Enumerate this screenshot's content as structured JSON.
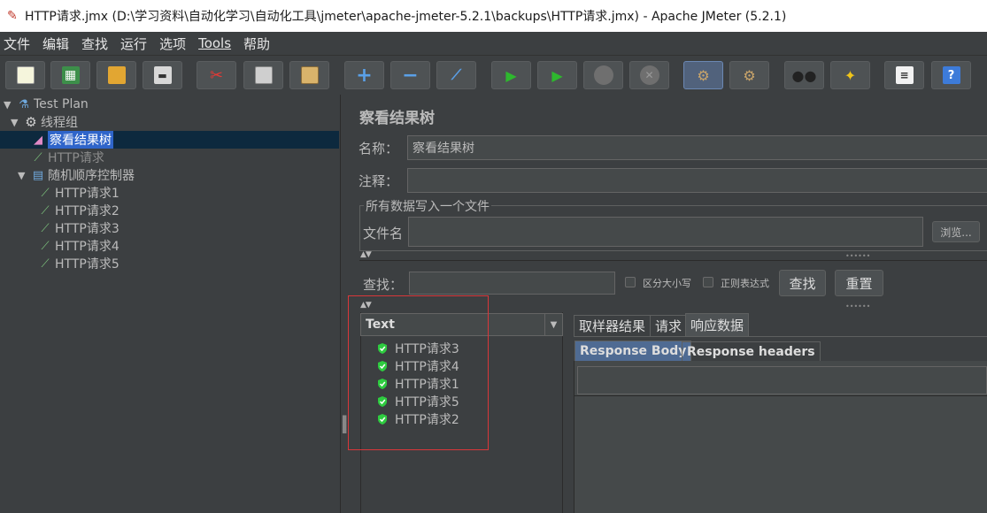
{
  "window": {
    "title": "HTTP请求.jmx (D:\\学习资料\\自动化学习\\自动化工具\\jmeter\\apache-jmeter-5.2.1\\backups\\HTTP请求.jmx) - Apache JMeter (5.2.1)"
  },
  "menu": [
    "文件",
    "编辑",
    "查找",
    "运行",
    "选项",
    "Tools",
    "帮助"
  ],
  "toolbar": {
    "icons": [
      "new-icon",
      "templates-icon",
      "open-icon",
      "save-icon",
      "cut-icon",
      "copy-icon",
      "paste-icon",
      "expand-icon",
      "collapse-icon",
      "toggle-icon",
      "start-icon",
      "start-no-pause-icon",
      "stop-icon",
      "shutdown-icon",
      "clear-icon",
      "clear-all-icon",
      "search-icon",
      "reset-search-icon",
      "function-helper-icon",
      "help-icon"
    ]
  },
  "tree": {
    "items": [
      {
        "label": "Test Plan",
        "icon": "test-plan-icon"
      },
      {
        "label": "线程组",
        "icon": "gear-icon"
      },
      {
        "label": "察看结果树",
        "icon": "chart-icon"
      },
      {
        "label": "HTTP请求",
        "icon": "pipette-icon"
      },
      {
        "label": "随机顺序控制器",
        "icon": "controller-icon"
      },
      {
        "label": "HTTP请求1",
        "icon": "pipette-icon"
      },
      {
        "label": "HTTP请求2",
        "icon": "pipette-icon"
      },
      {
        "label": "HTTP请求3",
        "icon": "pipette-icon"
      },
      {
        "label": "HTTP请求4",
        "icon": "pipette-icon"
      },
      {
        "label": "HTTP请求5",
        "icon": "pipette-icon"
      }
    ]
  },
  "panel": {
    "title": "察看结果树",
    "name_label": "名称：",
    "name_value": "察看结果树",
    "comment_label": "注释：",
    "comment_value": "",
    "fileset_legend": "所有数据写入一个文件",
    "filename_label": "文件名",
    "filename_value": "",
    "browse_button": "浏览...",
    "search_label": "查找：",
    "search_value": "",
    "case_sensitive_label": "区分大小写",
    "regex_label": "正则表达式",
    "find_button": "查找",
    "reset_button": "重置"
  },
  "results": {
    "renderer": "Text",
    "items": [
      "HTTP请求3",
      "HTTP请求4",
      "HTTP请求1",
      "HTTP请求5",
      "HTTP请求2"
    ]
  },
  "tabs": {
    "main": [
      "取样器结果",
      "请求",
      "响应数据"
    ],
    "active_main": "响应数据",
    "sub": [
      "Response Body",
      "Response headers"
    ],
    "active_sub": "Response Body"
  },
  "colors": {
    "background": "#3c3f41",
    "selection": "#2f65ca",
    "highlight_box": "#d9373a",
    "success_shield": "#2ecc40"
  }
}
